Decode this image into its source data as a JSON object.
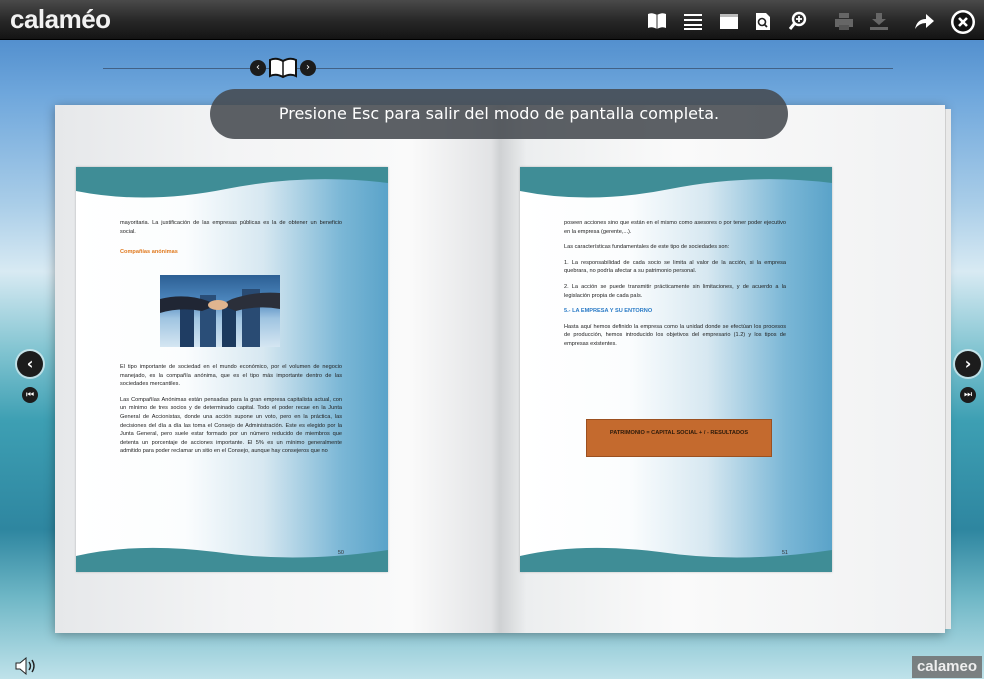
{
  "app": {
    "logo": "calaméo",
    "brand_badge": "calameo"
  },
  "toolbar": {
    "icons": [
      "book-view-icon",
      "list-view-icon",
      "window-icon",
      "search-page-icon",
      "zoom-icon",
      "print-icon",
      "download-icon",
      "share-icon",
      "close-icon"
    ]
  },
  "notice": "Presione Esc para salir del modo de pantalla completa.",
  "left_page": {
    "p1": "mayoritaria. La justificación de las empresas públicas es la de obtener un beneficio social.",
    "heading": "Compañías anónimas",
    "p2": "El tipo importante de sociedad en el mundo económico, por el volumen de negocio manejado, es la compañía anónima, que es el tipo más importante dentro de las sociedades mercantiles.",
    "p3": "Las Compañías Anónimas están pensadas para la gran empresa capitalista actual, con un mínimo de tres socios y de determinado capital. Todo el poder recae en la Junta General de Accionistas, donde una acción supone un voto, pero en la práctica, las decisiones del día a día las toma el Consejo de Administración. Este es elegido por la Junta General, pero suele estar formado por un número reducido de miembros que detenta un porcentaje de acciones importante. El 5% es un mínimo generalmente admitido para poder reclamar un sitio en el Consejo, aunque hay consejeros que no",
    "page_number": "50"
  },
  "right_page": {
    "p1": "poseen acciones sino que están en el mismo como asesores o por tener poder ejecutivo en la empresa (gerente,...).",
    "p2": "Las características fundamentales de este tipo de sociedades son:",
    "p3": "1. La responsabilidad de cada socio se limita al valor de la acción, si la empresa quebrara, no podría afectar a su patrimonio personal.",
    "p4": "2. La acción se puede transmitir prácticamente sin limitaciones, y de acuerdo a la legislación propia de cada país.",
    "heading": "5.- LA EMPRESA Y SU ENTORNO",
    "p5": "Hasta aquí hemos definido la empresa como la unidad donde se efectúan los procesos de producción, hemos introducido los objetivos del empresario (1.2) y los tipos de empresas existentes.",
    "callout": "PATRIMONIO = CAPITAL SOCIAL + / - RESULTADOS",
    "page_number": "51"
  },
  "colors": {
    "toolbar": "#1e1e1e",
    "accent_orange": "#c46a2e",
    "heading_orange": "#e07a1f",
    "heading_blue": "#2a7bc6"
  }
}
